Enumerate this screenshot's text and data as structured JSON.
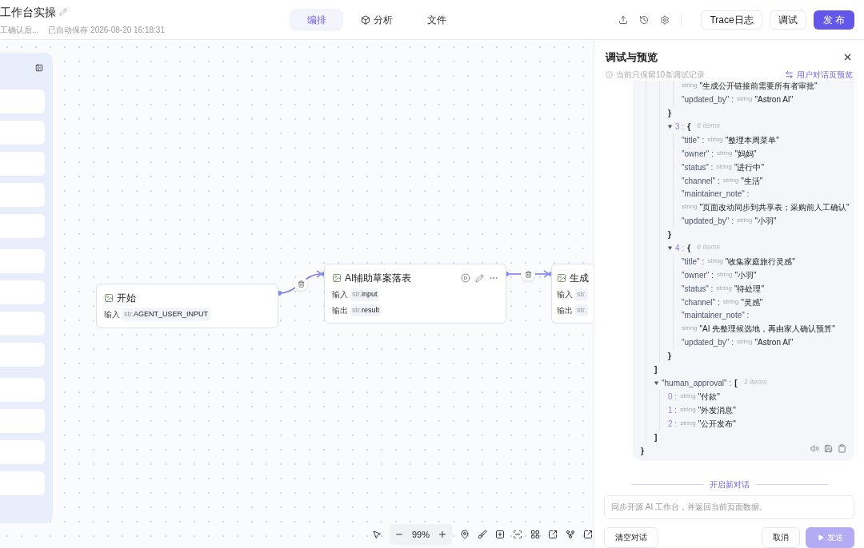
{
  "header": {
    "title": "工作台实操",
    "subtitle": "工确认后...",
    "autosave": "已自动保存 2026-08-20 16:18:31",
    "tabs": [
      {
        "label": "编排",
        "selected": true
      },
      {
        "label": "分析",
        "selected": false
      },
      {
        "label": "文件",
        "selected": false
      }
    ],
    "buttons": [
      {
        "label": "Trace日志",
        "kind": "outline"
      },
      {
        "label": "调试",
        "kind": "outline"
      },
      {
        "label": "发 布",
        "kind": "primary"
      }
    ]
  },
  "nodes": [
    {
      "title": "开始",
      "toolbar": false,
      "rows": [
        {
          "label": "输入",
          "type": "str.",
          "value": "AGENT_USER_INPUT"
        }
      ]
    },
    {
      "title": "AI辅助草案落表",
      "toolbar": true,
      "rows": [
        {
          "label": "输入",
          "type": "str.",
          "value": "input"
        },
        {
          "label": "输出",
          "type": "str.",
          "value": "result"
        }
      ]
    },
    {
      "title": "生成",
      "toolbar": false,
      "rows": [
        {
          "label": "输入",
          "type": "str."
        },
        {
          "label": "输出",
          "type": "str."
        }
      ]
    }
  ],
  "zoom": {
    "value": "99%"
  },
  "panel": {
    "title": "调试与预览",
    "note": "当前只保留10条调试记录",
    "preview_link": "用户对话页预览",
    "tree": {
      "close": "}",
      "children": [
        {
          "close": "]",
          "children": [
            {
              "close": "}",
              "children": [
                {
                  "type": "string",
                  "value": "\"生成公开链接前需要所有者审批\""
                },
                {
                  "key": "\"updated_by\" :",
                  "type": "string",
                  "value": "\"Astron AI\""
                }
              ]
            },
            {
              "key": "3 :",
              "index": true,
              "open": "{",
              "count": "6 items",
              "expanded": true,
              "close": "}",
              "children": [
                {
                  "key": "\"title\" :",
                  "type": "string",
                  "value": "\"整理本周菜单\""
                },
                {
                  "key": "\"owner\" :",
                  "type": "string",
                  "value": "\"妈妈\""
                },
                {
                  "key": "\"status\" :",
                  "type": "string",
                  "value": "\"进行中\""
                },
                {
                  "key": "\"channel\" :",
                  "type": "string",
                  "value": "\"生活\""
                },
                {
                  "key": "\"maintainer_note\" :",
                  "wrap": true,
                  "type": "string",
                  "value": "\"页面改动同步到共享表；采购前人工确认\""
                },
                {
                  "key": "\"updated_by\" :",
                  "type": "string",
                  "value": "\"小羽\""
                }
              ]
            },
            {
              "key": "4 :",
              "index": true,
              "open": "{",
              "count": "6 items",
              "expanded": true,
              "close": "}",
              "children": [
                {
                  "key": "\"title\" :",
                  "type": "string",
                  "value": "\"收集家庭旅行灵感\""
                },
                {
                  "key": "\"owner\" :",
                  "type": "string",
                  "value": "\"小羽\""
                },
                {
                  "key": "\"status\" :",
                  "type": "string",
                  "value": "\"待处理\""
                },
                {
                  "key": "\"channel\" :",
                  "type": "string",
                  "value": "\"灵感\""
                },
                {
                  "key": "\"maintainer_note\" :",
                  "wrap": true,
                  "type": "string",
                  "value": "\"AI 先整理候选地，再由家人确认预算\""
                },
                {
                  "key": "\"updated_by\" :",
                  "type": "string",
                  "value": "\"Astron AI\""
                }
              ]
            }
          ]
        },
        {
          "key": "\"human_approval\" :",
          "open": "[",
          "count": "3 items",
          "expanded": true,
          "close": "]",
          "children": [
            {
              "key": "0 :",
              "index": true,
              "type": "string",
              "value": "\"付款\""
            },
            {
              "key": "1 :",
              "index": true,
              "type": "string",
              "value": "\"外发消息\""
            },
            {
              "key": "2 :",
              "index": true,
              "type": "string",
              "value": "\"公开发布\""
            }
          ]
        }
      ]
    },
    "new_chat": "开启新对话",
    "input": {
      "placeholder": "同步开源 AI 工作台，并返回当前页面数据。"
    },
    "actions": [
      {
        "label": "清空对话",
        "kind": "clear",
        "disabled": false
      },
      {
        "label": "取消",
        "kind": "cancel",
        "disabled": false
      },
      {
        "label": "发送",
        "kind": "send",
        "disabled": true
      }
    ]
  }
}
